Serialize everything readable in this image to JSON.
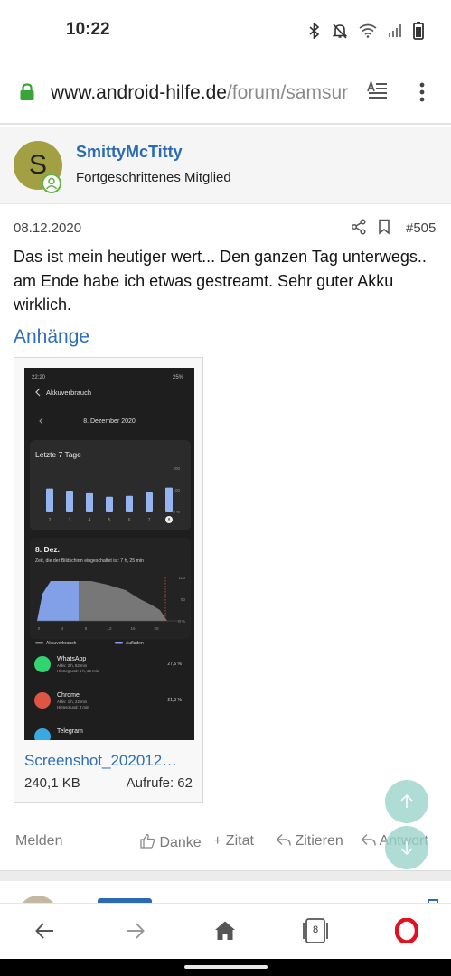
{
  "status_bar": {
    "time": "10:22"
  },
  "browser": {
    "url_host": "www.android-hilfe.de",
    "url_path": "/forum/samsur",
    "tab_count": "8"
  },
  "post": {
    "author": {
      "initial": "S",
      "name": "SmittyMcTitty",
      "title": "Fortgeschrittenes Mitglied"
    },
    "date": "08.12.2020",
    "number": "#505",
    "body": "Das ist mein heutiger wert... Den ganzen Tag unterwegs.. am Ende habe ich etwas gestreamt. Sehr guter Akku wirklich.",
    "attachments_label": "Anhänge",
    "attachment": {
      "file_name": "Screenshot_202012…",
      "size": "240,1 KB",
      "views": "Aufrufe: 62",
      "thumbnail": {
        "time": "22:20",
        "battery": "25%",
        "header": "Akkuverbrauch",
        "date": "8. Dezember 2020",
        "card_title": "Letzte 7 Tage",
        "week_y_ticks": [
          "200",
          "100",
          "0 %"
        ],
        "week_days": [
          "2",
          "3",
          "4",
          "5",
          "6",
          "7",
          "8"
        ],
        "week_bar_levels": [
          0.55,
          0.5,
          0.46,
          0.36,
          0.38,
          0.48,
          0.57
        ],
        "day_title": "8. Dez.",
        "day_subtitle": "Zeit, die der Bildschirm eingeschaltet ist: 7 h, 25 min",
        "day_y_ticks": [
          "100",
          "50",
          "0 %"
        ],
        "day_x_ticks": [
          "0",
          "4",
          "8",
          "12",
          "16",
          "20"
        ],
        "legend_usage": "Akkuverbrauch",
        "legend_charge": "Aufladen",
        "apps": [
          {
            "name": "WhatsApp",
            "detail1": "Aktiv: 2 h, 52 min",
            "detail2": "Hintergrund: 6 h, 26 min",
            "percent": "27,6 %",
            "color": "#25d366"
          },
          {
            "name": "Chrome",
            "detail1": "Aktiv: 1 h, 22 min",
            "detail2": "Hintergrund: 4 min",
            "percent": "21,3 %",
            "color": "#dd4b39"
          },
          {
            "name": "Telegram",
            "detail1": "",
            "detail2": "",
            "percent": "",
            "color": "#2ca5e0"
          }
        ],
        "colors": {
          "bar": "#8fb0f0",
          "area": "#7a9be6",
          "panel": "#1e1e1e"
        }
      }
    },
    "actions": {
      "report": "Melden",
      "like": "Danke",
      "quote": "Zitat",
      "reply_quote": "Zitieren",
      "reply": "Antwort"
    }
  },
  "colors": {
    "link": "#2f6fb6",
    "author_name": "#2c6bb2",
    "fab": "#99d2c9",
    "opera": "#e3101f",
    "lock": "#3aa537"
  }
}
